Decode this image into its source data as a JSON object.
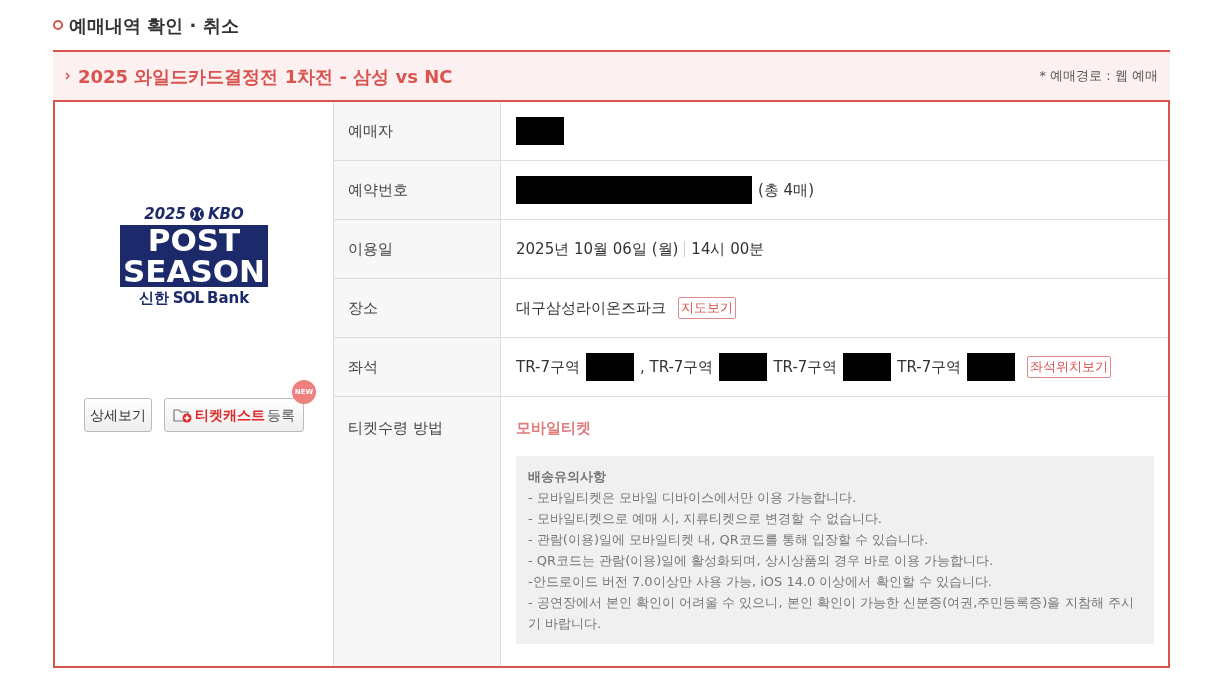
{
  "page_title": "예매내역 확인 · 취소",
  "event": {
    "title": "2025 와일드카드결정전 1차전 - 삼성 vs NC",
    "channel": "* 예매경로 : 웹 예매"
  },
  "logo": {
    "year": "2025",
    "org": "KBO",
    "line1": "POST",
    "line2": "SEASON",
    "sponsor_a": "신한",
    "sponsor_b": "SOL",
    "sponsor_c": "Bank"
  },
  "buttons": {
    "detail": "상세보기",
    "ticketcast_highlight": "티켓캐스트",
    "ticketcast_rest": "등록",
    "new_badge": "NEW"
  },
  "rows": [
    {
      "label": "예매자",
      "segments": [
        {
          "kind": "redacted"
        }
      ]
    },
    {
      "label": "예약번호",
      "segments": [
        {
          "kind": "redacted_long"
        },
        {
          "kind": "text",
          "text": "(총 4매)"
        }
      ]
    },
    {
      "label": "이용일",
      "segments": [
        {
          "kind": "text",
          "text": "2025년 10월 06일 (월)"
        },
        {
          "kind": "separator"
        },
        {
          "kind": "text",
          "text": "14시 00분"
        }
      ]
    },
    {
      "label": "장소",
      "segments": [
        {
          "kind": "text",
          "text": "대구삼성라이온즈파크"
        },
        {
          "kind": "link",
          "text": "지도보기"
        }
      ]
    },
    {
      "label": "좌석",
      "segments": [
        {
          "kind": "text",
          "text": "TR-7구역"
        },
        {
          "kind": "redacted"
        },
        {
          "kind": "text",
          "text": ", TR-7구역"
        },
        {
          "kind": "redacted"
        },
        {
          "kind": "text",
          "text": "TR-7구역"
        },
        {
          "kind": "redacted"
        },
        {
          "kind": "text",
          "text": "TR-7구역"
        },
        {
          "kind": "redacted"
        },
        {
          "kind": "link",
          "text": "좌석위치보기"
        }
      ]
    },
    {
      "label": "티켓수령 방법",
      "segments": [
        {
          "kind": "accent",
          "text": "모바일티켓"
        }
      ]
    }
  ],
  "notice": {
    "title": "배송유의사항",
    "lines": [
      "- 모바일티켓은 모바일 디바이스에서만 이용 가능합니다.",
      "- 모바일티켓으로 예매 시, 지류티켓으로 변경할 수 없습니다.",
      "- 관람(이용)일에 모바일티켓 내, QR코드를 통해 입장할 수 있습니다.",
      "- QR코드는 관람(이용)일에 활성화되며, 상시상품의 경우 바로 이용 가능합니다.",
      "-안드로이드 버전 7.0이상만 사용 가능, iOS 14.0 이상에서 확인할 수 있습니다.",
      "- 공연장에서 본인 확인이 어려울 수 있으니, 본인 확인이 가능한 신분증(여권,주민등록증)을 지참해 주시기 바랍니다."
    ]
  }
}
